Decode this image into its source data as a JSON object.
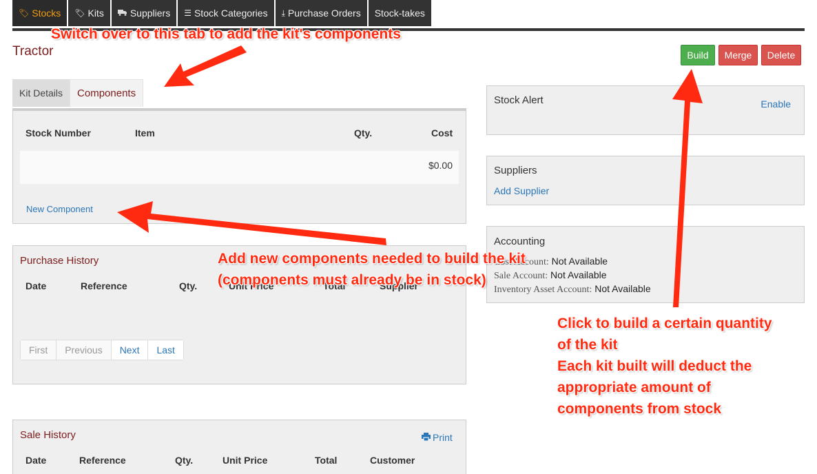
{
  "nav": {
    "tabs": [
      {
        "label": "Stocks",
        "icon": "tags-icon"
      },
      {
        "label": "Kits",
        "icon": "tags-icon"
      },
      {
        "label": "Suppliers",
        "icon": "truck-icon"
      },
      {
        "label": "Stock Categories",
        "icon": "list-icon"
      },
      {
        "label": "Purchase Orders",
        "icon": "download-icon"
      },
      {
        "label": "Stock-takes",
        "icon": ""
      }
    ],
    "active_color": "#f39c12"
  },
  "page": {
    "title": "Tractor"
  },
  "actions": {
    "build": "Build",
    "merge": "Merge",
    "delete": "Delete",
    "build_color": "#4cae4c",
    "merge_color": "#d9534f"
  },
  "kit_tabs": {
    "details": "Kit Details",
    "components": "Components"
  },
  "components": {
    "headers": {
      "stock_number": "Stock Number",
      "item": "Item",
      "qty": "Qty.",
      "cost": "Cost"
    },
    "total": "$0.00",
    "new_link": "New Component"
  },
  "purchase_history": {
    "title": "Purchase History",
    "headers": {
      "date": "Date",
      "reference": "Reference",
      "qty": "Qty.",
      "unit_price": "Unit Price",
      "total": "Total",
      "supplier": "Supplier"
    },
    "pager": {
      "first": "First",
      "previous": "Previous",
      "next": "Next",
      "last": "Last"
    }
  },
  "sale_history": {
    "title": "Sale History",
    "print": "Print",
    "headers": {
      "date": "Date",
      "reference": "Reference",
      "qty": "Qty.",
      "unit_price": "Unit Price",
      "total": "Total",
      "customer": "Customer"
    }
  },
  "stock_alert": {
    "title": "Stock Alert",
    "enable": "Enable"
  },
  "suppliers": {
    "title": "Suppliers",
    "add": "Add Supplier"
  },
  "accounting": {
    "title": "Accounting",
    "rows": [
      {
        "label": "Cost Account:",
        "value": "Not Available"
      },
      {
        "label": "Sale Account:",
        "value": "Not Available"
      },
      {
        "label": "Inventory Asset Account:",
        "value": "Not Available"
      }
    ]
  },
  "annotations": {
    "tab_hint": "Switch over to this tab to add the kit's components",
    "component_hint_1": "Add new components needed to build the kit",
    "component_hint_2": "(components must already be in stock)",
    "build_hint": [
      "Click to build a certain quantity",
      "of the kit",
      "Each kit built will deduct the",
      "appropriate amount of",
      "components from stock"
    ],
    "color": "#ff2a10"
  }
}
